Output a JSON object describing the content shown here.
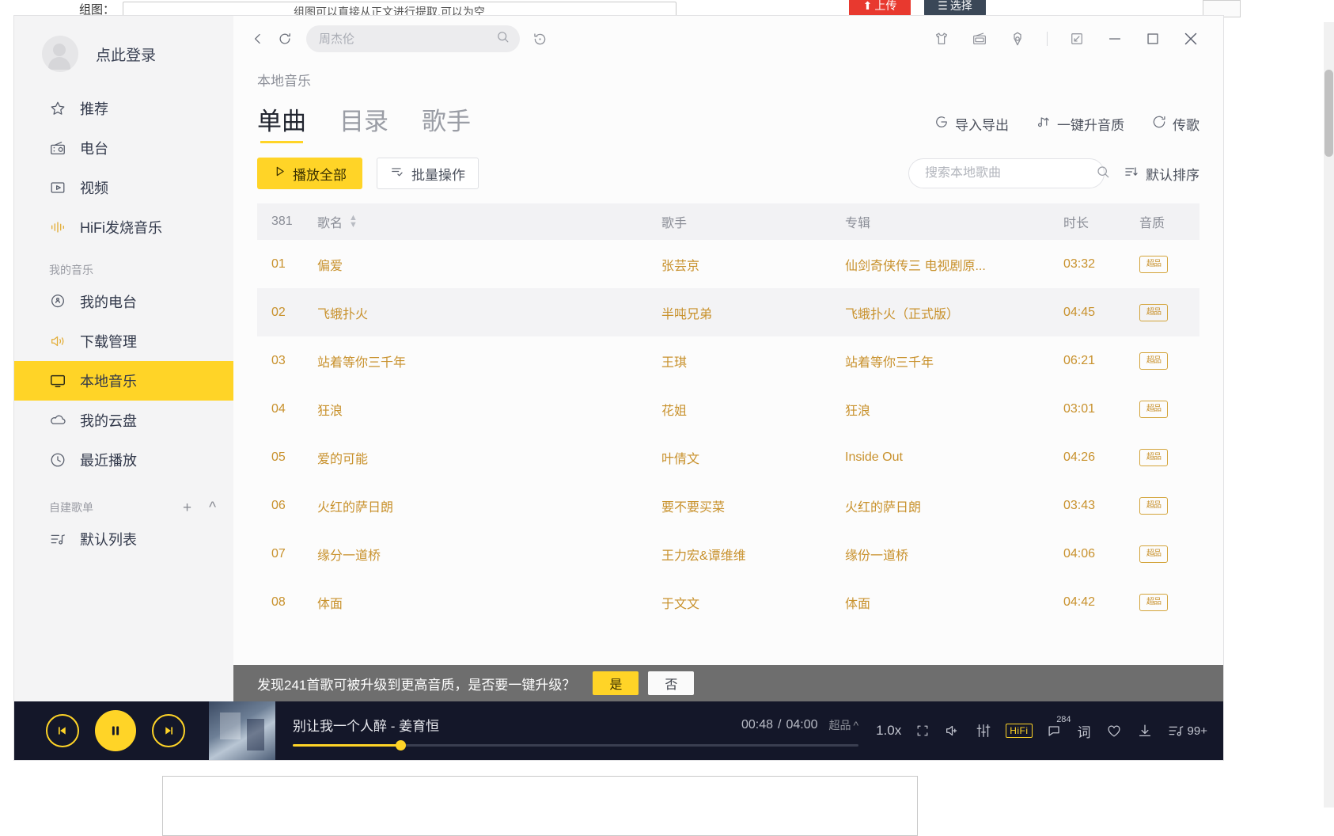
{
  "background": {
    "label": "组图：",
    "input_text": "组图可以直接从正文进行提取,可以为空",
    "upload_button": "上传",
    "select_button": "选择",
    "right_column": [
      "",
      "",
      "",
      "",
      "",
      ""
    ]
  },
  "sidebar": {
    "user": {
      "login_text": "点此登录"
    },
    "nav": [
      {
        "label": "推荐",
        "icon": "star-icon",
        "selected": false
      },
      {
        "label": "电台",
        "icon": "radio-icon",
        "selected": false
      },
      {
        "label": "视频",
        "icon": "video-icon",
        "selected": false
      },
      {
        "label": "HiFi发烧音乐",
        "icon": "equalizer-icon",
        "selected": false
      }
    ],
    "my_music_title": "我的音乐",
    "my_music": [
      {
        "label": "我的电台",
        "icon": "my-radio-icon",
        "selected": false
      },
      {
        "label": "下载管理",
        "icon": "download-speaker-icon",
        "selected": false
      },
      {
        "label": "本地音乐",
        "icon": "monitor-icon",
        "selected": true
      },
      {
        "label": "我的云盘",
        "icon": "cloud-icon",
        "selected": false
      },
      {
        "label": "最近播放",
        "icon": "clock-icon",
        "selected": false
      }
    ],
    "playlist_title": "自建歌单",
    "playlist_add": "+",
    "playlist_collapse": "^",
    "playlists": [
      {
        "label": "默认列表",
        "icon": "playlist-icon"
      }
    ]
  },
  "topbar": {
    "back_icon": "chevron-left-icon",
    "refresh_icon": "refresh-icon",
    "search_placeholder": "周杰伦",
    "search_value": "",
    "search_icon": "search-icon",
    "history_icon": "history-icon",
    "right_icons": [
      "tshirt-skin-icon",
      "fm-radio-icon",
      "gear-settings-icon"
    ],
    "mini_icon": "mini-mode-icon",
    "minimize_icon": "minimize-icon",
    "maximize_icon": "maximize-icon",
    "close_icon": "close-icon"
  },
  "main": {
    "breadcrumb": "本地音乐",
    "tabs": [
      {
        "label": "单曲",
        "selected": true
      },
      {
        "label": "目录",
        "selected": false
      },
      {
        "label": "歌手",
        "selected": false
      }
    ],
    "tab_actions": [
      {
        "label": "导入导出",
        "icon": "import-export-icon"
      },
      {
        "label": "一键升音质",
        "icon": "note-upgrade-icon"
      },
      {
        "label": "传歌",
        "icon": "transfer-icon"
      }
    ],
    "play_all": "播放全部",
    "batch_ops": "批量操作",
    "local_search_placeholder": "搜索本地歌曲",
    "local_search_value": "",
    "sort_label": "默认排序",
    "table": {
      "count": "381",
      "headers": {
        "name": "歌名",
        "artist": "歌手",
        "album": "专辑",
        "duration": "时长",
        "quality": "音质"
      },
      "rows": [
        {
          "idx": "01",
          "name": "偏爱",
          "artist": "张芸京",
          "album": "仙剑奇侠传三  电视剧原...",
          "duration": "03:32",
          "quality": "超品"
        },
        {
          "idx": "02",
          "name": "飞蛾扑火",
          "artist": "半吨兄弟",
          "album": "飞蛾扑火（正式版）",
          "duration": "04:45",
          "quality": "超品"
        },
        {
          "idx": "03",
          "name": "站着等你三千年",
          "artist": "王琪",
          "album": "站着等你三千年",
          "duration": "06:21",
          "quality": "超品"
        },
        {
          "idx": "04",
          "name": "狂浪",
          "artist": "花姐",
          "album": "狂浪",
          "duration": "03:01",
          "quality": "超品"
        },
        {
          "idx": "05",
          "name": "爱的可能",
          "artist": "叶倩文",
          "album": "Inside Out",
          "duration": "04:26",
          "quality": "超品"
        },
        {
          "idx": "06",
          "name": "火红的萨日朗",
          "artist": "要不要买菜",
          "album": "火红的萨日朗",
          "duration": "03:43",
          "quality": "超品"
        },
        {
          "idx": "07",
          "name": "缘分一道桥",
          "artist": "王力宏&谭维维",
          "album": "缘份一道桥",
          "duration": "04:06",
          "quality": "超品"
        },
        {
          "idx": "08",
          "name": "体面",
          "artist": "于文文",
          "album": "体面",
          "duration": "04:42",
          "quality": "超品"
        }
      ]
    }
  },
  "toast": {
    "message": "发现241首歌可被升级到更高音质，是否要一键升级？",
    "yes": "是",
    "no": "否"
  },
  "player": {
    "prev_icon": "previous-track-icon",
    "play_pause_icon": "pause-icon",
    "next_icon": "next-track-icon",
    "cover_name": "album-cover",
    "now_playing": "别让我一个人醉 - 姜育恒",
    "elapsed": "00:48",
    "separator": "/",
    "total": "04:00",
    "quality_label": "超品",
    "quality_caret": "^",
    "progress_percent": 19,
    "speed": "1.0x",
    "icons": [
      {
        "name": "crop-lyric-icon",
        "label": ""
      },
      {
        "name": "volume-plus-icon",
        "label": ""
      },
      {
        "name": "equalizer-sliders-icon",
        "label": ""
      },
      {
        "name": "hifi-badge-icon",
        "label": "HiFi"
      },
      {
        "name": "comment-icon",
        "label": "284"
      },
      {
        "name": "lyrics-word-icon",
        "label": "词"
      },
      {
        "name": "favorite-heart-icon",
        "label": ""
      },
      {
        "name": "download-icon",
        "label": ""
      },
      {
        "name": "playlist-queue-icon",
        "label": "99+"
      }
    ]
  }
}
